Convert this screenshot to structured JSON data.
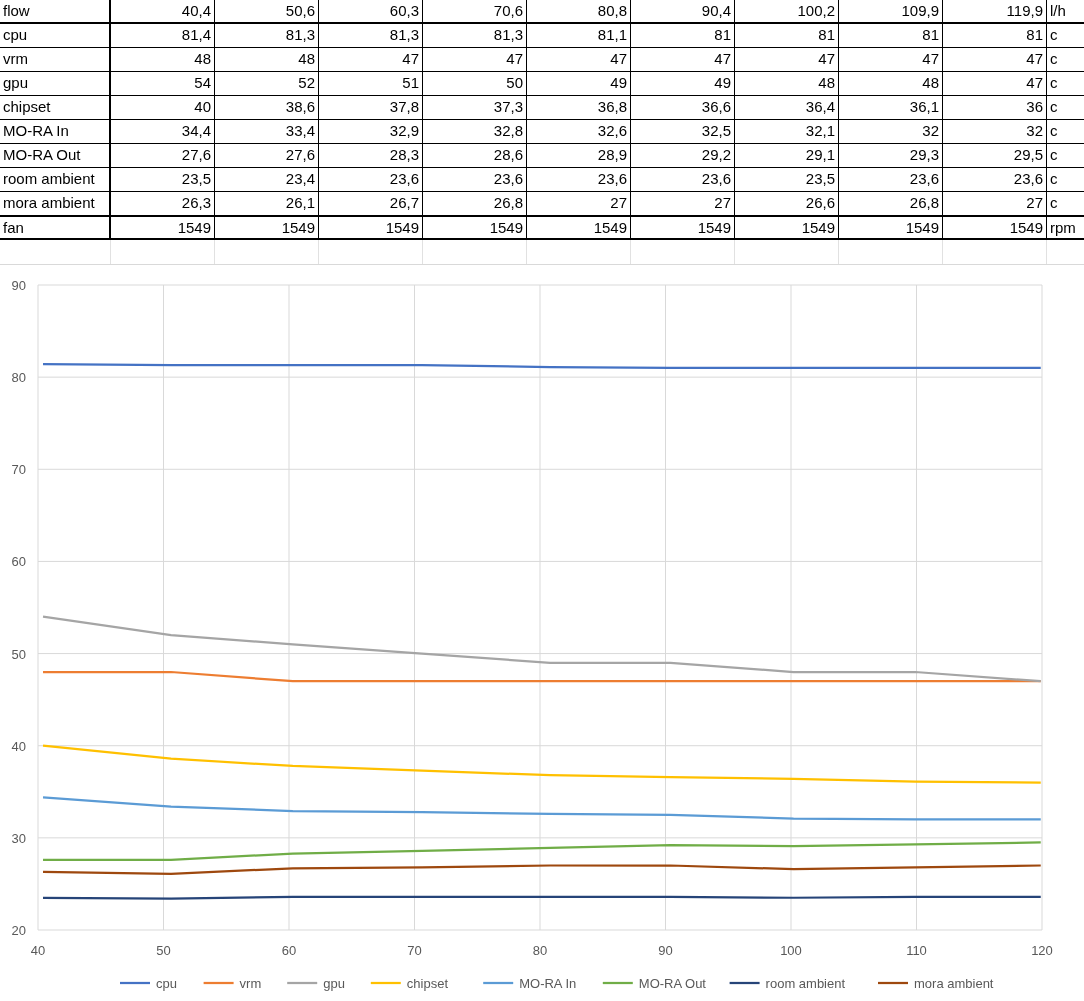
{
  "table": {
    "rows": [
      {
        "kind": "header",
        "label": "flow",
        "values": [
          "40,4",
          "50,6",
          "60,3",
          "70,6",
          "80,8",
          "90,4",
          "100,2",
          "109,9",
          "119,9"
        ],
        "unit": "l/h"
      },
      {
        "kind": "data",
        "label": "cpu",
        "values": [
          "81,4",
          "81,3",
          "81,3",
          "81,3",
          "81,1",
          "81",
          "81",
          "81",
          "81"
        ],
        "unit": "c"
      },
      {
        "kind": "data",
        "label": "vrm",
        "values": [
          "48",
          "48",
          "47",
          "47",
          "47",
          "47",
          "47",
          "47",
          "47"
        ],
        "unit": "c"
      },
      {
        "kind": "data",
        "label": "gpu",
        "values": [
          "54",
          "52",
          "51",
          "50",
          "49",
          "49",
          "48",
          "48",
          "47"
        ],
        "unit": "c"
      },
      {
        "kind": "data",
        "label": "chipset",
        "values": [
          "40",
          "38,6",
          "37,8",
          "37,3",
          "36,8",
          "36,6",
          "36,4",
          "36,1",
          "36"
        ],
        "unit": "c"
      },
      {
        "kind": "data",
        "label": "MO-RA In",
        "values": [
          "34,4",
          "33,4",
          "32,9",
          "32,8",
          "32,6",
          "32,5",
          "32,1",
          "32",
          "32"
        ],
        "unit": "c"
      },
      {
        "kind": "data",
        "label": "MO-RA Out",
        "values": [
          "27,6",
          "27,6",
          "28,3",
          "28,6",
          "28,9",
          "29,2",
          "29,1",
          "29,3",
          "29,5"
        ],
        "unit": "c"
      },
      {
        "kind": "data",
        "label": "room ambient",
        "values": [
          "23,5",
          "23,4",
          "23,6",
          "23,6",
          "23,6",
          "23,6",
          "23,5",
          "23,6",
          "23,6"
        ],
        "unit": "c"
      },
      {
        "kind": "data",
        "label": "mora ambient",
        "values": [
          "26,3",
          "26,1",
          "26,7",
          "26,8",
          "27",
          "27",
          "26,6",
          "26,8",
          "27"
        ],
        "unit": "c"
      },
      {
        "kind": "footer",
        "label": "fan",
        "values": [
          "1549",
          "1549",
          "1549",
          "1549",
          "1549",
          "1549",
          "1549",
          "1549",
          "1549"
        ],
        "unit": "rpm"
      }
    ]
  },
  "chart": {
    "chart_data": {
      "type": "line",
      "grid": true,
      "legend": true,
      "x": [
        40.4,
        50.6,
        60.3,
        70.6,
        80.8,
        90.4,
        100.2,
        109.9,
        119.9
      ],
      "xlim": [
        40,
        120
      ],
      "ylim": [
        20,
        90
      ],
      "xticks": [
        40,
        50,
        60,
        70,
        80,
        90,
        100,
        110,
        120
      ],
      "yticks": [
        20,
        30,
        40,
        50,
        60,
        70,
        80,
        90
      ],
      "series": [
        {
          "name": "cpu",
          "color": "#4472c4",
          "values": [
            81.4,
            81.3,
            81.3,
            81.3,
            81.1,
            81,
            81,
            81,
            81
          ]
        },
        {
          "name": "vrm",
          "color": "#ed7d31",
          "values": [
            48,
            48,
            47,
            47,
            47,
            47,
            47,
            47,
            47
          ]
        },
        {
          "name": "gpu",
          "color": "#a5a5a5",
          "values": [
            54,
            52,
            51,
            50,
            49,
            49,
            48,
            48,
            47
          ]
        },
        {
          "name": "chipset",
          "color": "#ffc000",
          "values": [
            40,
            38.6,
            37.8,
            37.3,
            36.8,
            36.6,
            36.4,
            36.1,
            36
          ]
        },
        {
          "name": "MO-RA In",
          "color": "#5b9bd5",
          "values": [
            34.4,
            33.4,
            32.9,
            32.8,
            32.6,
            32.5,
            32.1,
            32,
            32
          ]
        },
        {
          "name": "MO-RA Out",
          "color": "#70ad47",
          "values": [
            27.6,
            27.6,
            28.3,
            28.6,
            28.9,
            29.2,
            29.1,
            29.3,
            29.5
          ]
        },
        {
          "name": "room ambient",
          "color": "#264478",
          "values": [
            23.5,
            23.4,
            23.6,
            23.6,
            23.6,
            23.6,
            23.5,
            23.6,
            23.6
          ]
        },
        {
          "name": "mora ambient",
          "color": "#9e480e",
          "values": [
            26.3,
            26.1,
            26.7,
            26.8,
            27,
            27,
            26.6,
            26.8,
            27
          ]
        }
      ]
    }
  }
}
